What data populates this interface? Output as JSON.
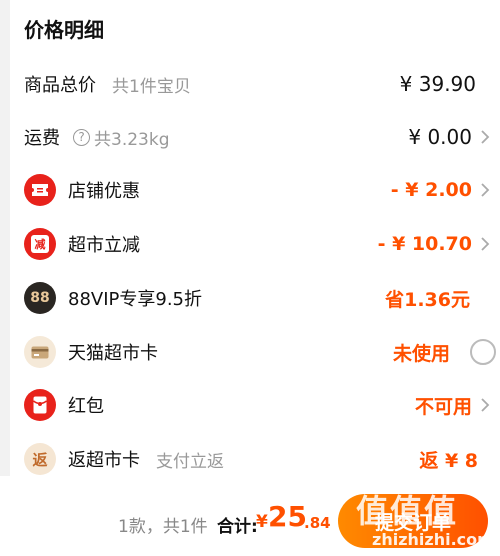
{
  "section_title": "价格明细",
  "rows": {
    "product_total": {
      "label": "商品总价",
      "sub": "共1件宝贝",
      "value": "¥ 39.90"
    },
    "shipping": {
      "label": "运费",
      "sub": "共3.23kg",
      "value": "¥ 0.00"
    },
    "store_discount": {
      "label": "店铺优惠",
      "value": "- ¥ 2.00"
    },
    "supermarket_discount": {
      "label": "超市立减",
      "icon_text": "减",
      "value": "- ¥ 10.70"
    },
    "vip88": {
      "label": "88VIP专享9.5折",
      "icon_text": "88",
      "value": "省1.36元"
    },
    "tmall_card": {
      "label": "天猫超市卡",
      "value": "未使用"
    },
    "red_packet": {
      "label": "红包",
      "value": "不可用"
    },
    "cashback_card": {
      "label": "返超市卡",
      "icon_text": "返",
      "sub": "支付立返",
      "value": "返 ¥ 8"
    }
  },
  "footer": {
    "count": "1款，共1件",
    "total_label": "合计:",
    "currency": "¥",
    "total_big": "25",
    "total_small": ".84",
    "submit_label": "提交订单"
  },
  "watermark": {
    "text": "值值值",
    "url": "zhizhizhi.com"
  },
  "colors": {
    "accent": "#ff5000",
    "icon_red": "#e8221b",
    "vip_dark": "#2a2622"
  }
}
